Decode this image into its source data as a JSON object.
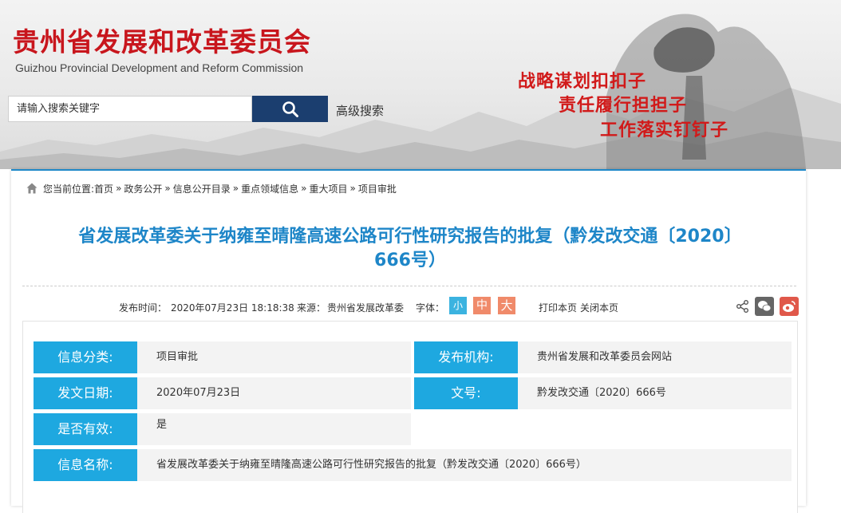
{
  "header": {
    "title_cn": "贵州省发展和改革委员会",
    "title_en": "Guizhou Provincial Development and Reform Commission",
    "search_placeholder": "请输入搜索关键字",
    "advanced_search": "高级搜索",
    "slogans": [
      "战略谋划扣扣子",
      "责任履行担担子",
      "工作落实钉钉子"
    ],
    "accent_color": "#c8161d"
  },
  "breadcrumb": {
    "prefix": "您当前位置:",
    "items": [
      "首页",
      "政务公开",
      "信息公开目录",
      "重点领域信息",
      "重大项目",
      "项目审批"
    ],
    "separator": "»"
  },
  "article": {
    "title_line1": "省发展改革委关于纳雍至晴隆高速公路可行性研究报告的批复（黔发改交通〔2020〕",
    "title_line2": "666号）",
    "title_color": "#1e86c8"
  },
  "meta": {
    "publish_label": "发布时间：",
    "publish_time": "2020年07月23日 18:18:38",
    "source_label": "来源：",
    "source": "贵州省发展改革委",
    "font_label": "字体：",
    "font_small": "小",
    "font_medium": "中",
    "font_large": "大",
    "print": "打印本页",
    "close": "关闭本页"
  },
  "info": {
    "category_label": "信息分类:",
    "category_value": "项目审批",
    "publisher_label": "发布机构:",
    "publisher_value": "贵州省发展和改革委员会网站",
    "date_label": "发文日期:",
    "date_value": "2020年07月23日",
    "docno_label": "文号:",
    "docno_value": "黔发改交通〔2020〕666号",
    "valid_label": "是否有效:",
    "valid_value": "是",
    "name_label": "信息名称:",
    "name_value": "省发展改革委关于纳雍至晴隆高速公路可行性研究报告的批复（黔发改交通〔2020〕666号）",
    "label_color": "#1ea8e0"
  }
}
